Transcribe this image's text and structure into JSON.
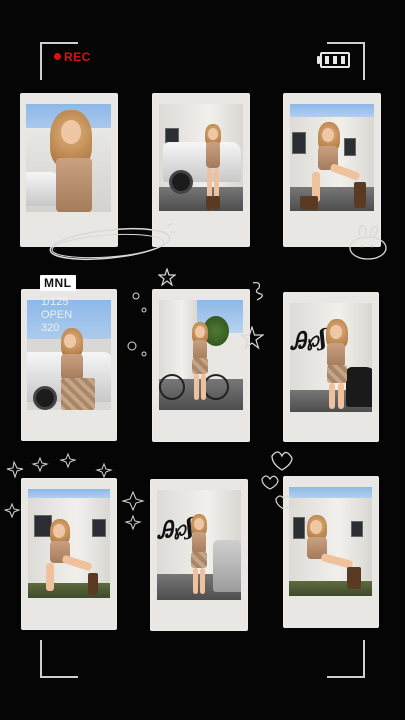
{
  "recorder": {
    "rec_label": "REC",
    "rec_color": "#dd1111",
    "battery_level_bars": 3
  },
  "overlay": {
    "location_tag": "MNL",
    "shutter": "1/125",
    "aperture": "OPEN",
    "iso": "320"
  },
  "polaroids": [
    {
      "id": 1,
      "scene": "closeup-by-car"
    },
    {
      "id": 2,
      "scene": "standing-by-white-suv"
    },
    {
      "id": 3,
      "scene": "sitting-by-building"
    },
    {
      "id": 4,
      "scene": "leaning-on-car"
    },
    {
      "id": 5,
      "scene": "bike-and-tree"
    },
    {
      "id": 6,
      "scene": "graffiti-wall-closeup"
    },
    {
      "id": 7,
      "scene": "seated-by-wall"
    },
    {
      "id": 8,
      "scene": "standing-by-graffiti"
    },
    {
      "id": 9,
      "scene": "seated-on-steps"
    }
  ],
  "doodles": [
    "oval-scribble",
    "bunny-doodle",
    "star-doodle",
    "heart-doodle",
    "sparkle-doodle"
  ]
}
